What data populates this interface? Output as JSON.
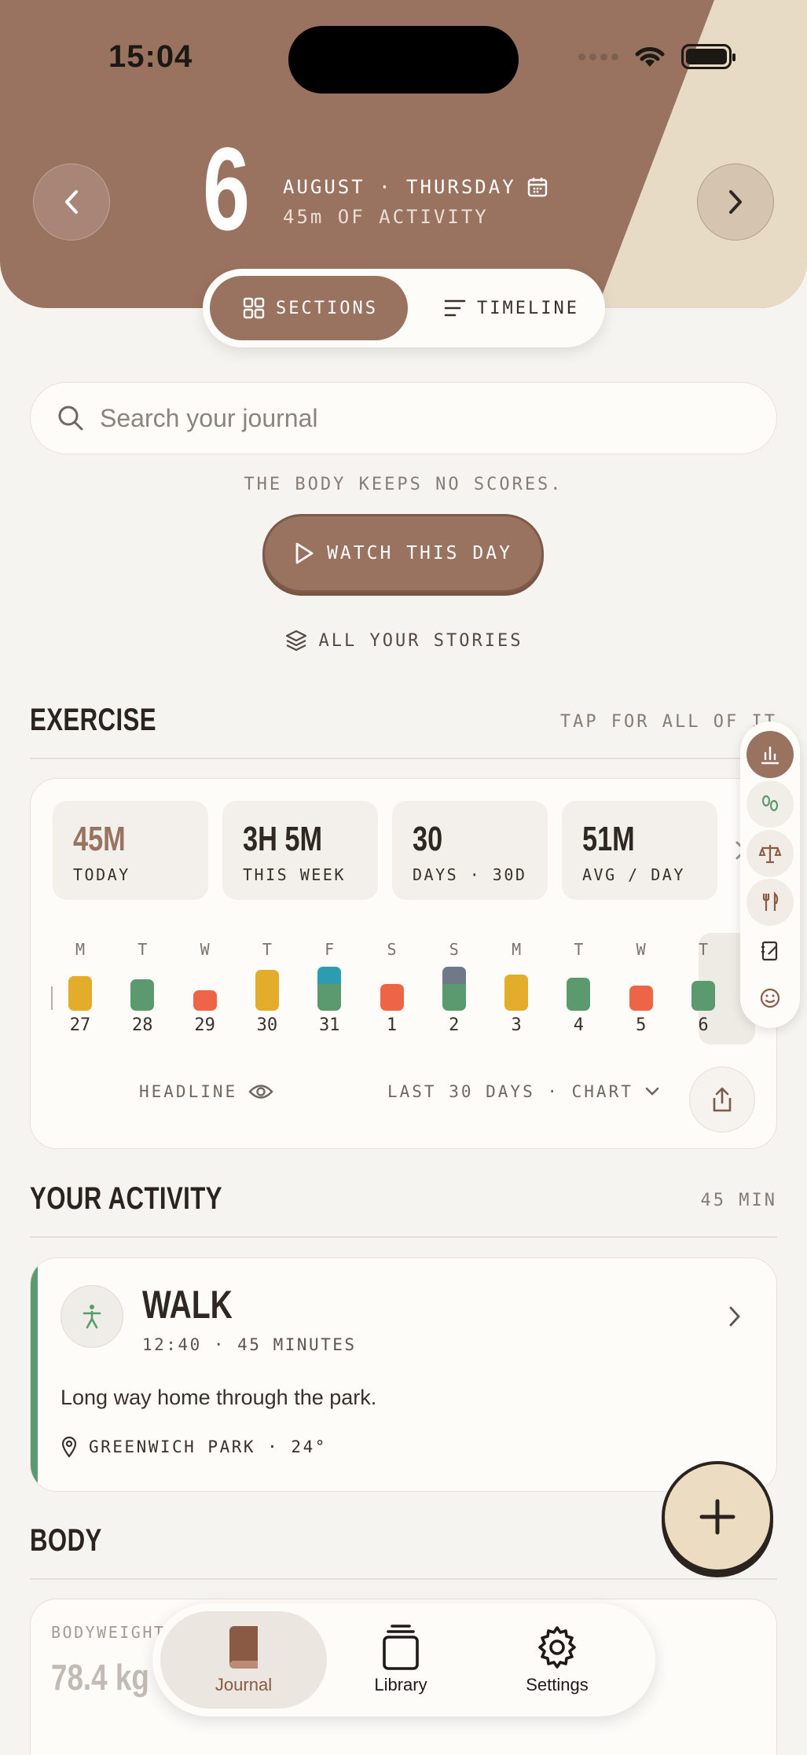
{
  "status": {
    "time": "15:04"
  },
  "header": {
    "day": "6",
    "date_line": "AUGUST · THURSDAY",
    "activity_line": "45m OF ACTIVITY",
    "prev_icon": "chevron-left-icon",
    "next_icon": "chevron-right-icon",
    "colors": {
      "brown": "#9a7260",
      "beige": "#e8dbc5"
    }
  },
  "view_toggle": {
    "sections": "SECTIONS",
    "timeline": "TIMELINE",
    "selected": "SECTIONS"
  },
  "search": {
    "placeholder": "Search your journal",
    "value": ""
  },
  "tagline": "THE BODY KEEPS NO SCORES.",
  "watch_button": "WATCH THIS DAY",
  "stories_link": "ALL YOUR STORIES",
  "exercise": {
    "title": "EXERCISE",
    "link": "TAP FOR ALL OF IT",
    "stats": [
      {
        "value": "45M",
        "label": "TODAY"
      },
      {
        "value": "3H 5M",
        "label": "THIS WEEK"
      },
      {
        "value": "30",
        "label": "DAYS · 30D"
      },
      {
        "value": "51M",
        "label": "AVG / DAY"
      }
    ],
    "days": [
      {
        "wd": "M",
        "d": "27"
      },
      {
        "wd": "T",
        "d": "28"
      },
      {
        "wd": "W",
        "d": "29"
      },
      {
        "wd": "T",
        "d": "30"
      },
      {
        "wd": "F",
        "d": "31"
      },
      {
        "wd": "S",
        "d": "1"
      },
      {
        "wd": "S",
        "d": "2"
      },
      {
        "wd": "M",
        "d": "3"
      },
      {
        "wd": "T",
        "d": "4"
      },
      {
        "wd": "W",
        "d": "5"
      },
      {
        "wd": "T",
        "d": "6"
      }
    ],
    "headline": "HEADLINE",
    "range": "LAST 30 DAYS · CHART"
  },
  "activity": {
    "title": "YOUR ACTIVITY",
    "total": "45 MIN",
    "entry": {
      "name": "WALK",
      "meta": "12:40 · 45 MINUTES",
      "note": "Long way home through the park.",
      "location": "GREENWICH PARK · 24°",
      "accent": "#5b9a6e"
    }
  },
  "body": {
    "title": "BODY",
    "metric_label": "BODYWEIGHT",
    "metric_value": "78.4 kg"
  },
  "tabs": {
    "journal": "Journal",
    "library": "Library",
    "settings": "Settings",
    "selected": "Journal"
  }
}
